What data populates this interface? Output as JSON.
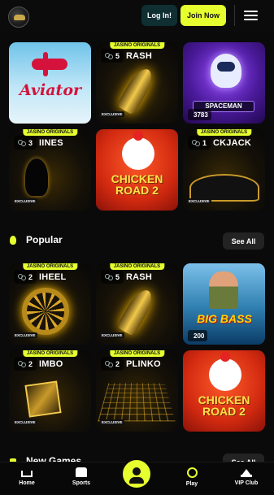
{
  "header": {
    "login_label": "Log In!",
    "join_label": "Join Now"
  },
  "top_grid": [
    {
      "name": "",
      "badge": "",
      "players": "",
      "exclusive": ""
    },
    {
      "name": "RASH",
      "badge": "JASINO ORIGINALS",
      "players": "5",
      "exclusive": "EXCLUSIVE"
    },
    {
      "name": "SPACEMAN",
      "badge": "",
      "players": "3783",
      "exclusive": ""
    },
    {
      "name": "IINES",
      "badge": "JASINO ORIGINALS",
      "players": "3",
      "exclusive": "EXCLUSIVE"
    },
    {
      "name": "CHICKEN ROAD 2",
      "badge": "",
      "players": "",
      "exclusive": ""
    },
    {
      "name": "CKJACK",
      "badge": "JASINO ORIGINALS",
      "players": "1",
      "exclusive": "EXCLUSIVE"
    }
  ],
  "aviator_title": "Aviator",
  "popular": {
    "title": "Popular",
    "see_all": "See All",
    "tiles": [
      {
        "name": "IHEEL",
        "badge": "JASINO ORIGINALS",
        "players": "2",
        "exclusive": "EXCLUSIVE"
      },
      {
        "name": "RASH",
        "badge": "JASINO ORIGINALS",
        "players": "5",
        "exclusive": "EXCLUSIVE"
      },
      {
        "name": "BIG BASS",
        "badge": "",
        "players": "200",
        "exclusive": ""
      },
      {
        "name": "IMBO",
        "badge": "JASINO ORIGINALS",
        "players": "2",
        "exclusive": "EXCLUSIVE"
      },
      {
        "name": "PLINKO",
        "badge": "JASINO ORIGINALS",
        "players": "2",
        "exclusive": "EXCLUSIVE"
      },
      {
        "name": "CHICKEN ROAD 2",
        "badge": "",
        "players": "",
        "exclusive": ""
      }
    ]
  },
  "new_games": {
    "title": "New Games",
    "see_all": "See All"
  },
  "bottom_nav": {
    "home": "Home",
    "sports": "Sports",
    "play": "Play",
    "vip": "VIP Club"
  },
  "colors": {
    "accent": "#e6ff2e",
    "background": "#0a0a0a",
    "login_bg": "#0f2f33"
  }
}
